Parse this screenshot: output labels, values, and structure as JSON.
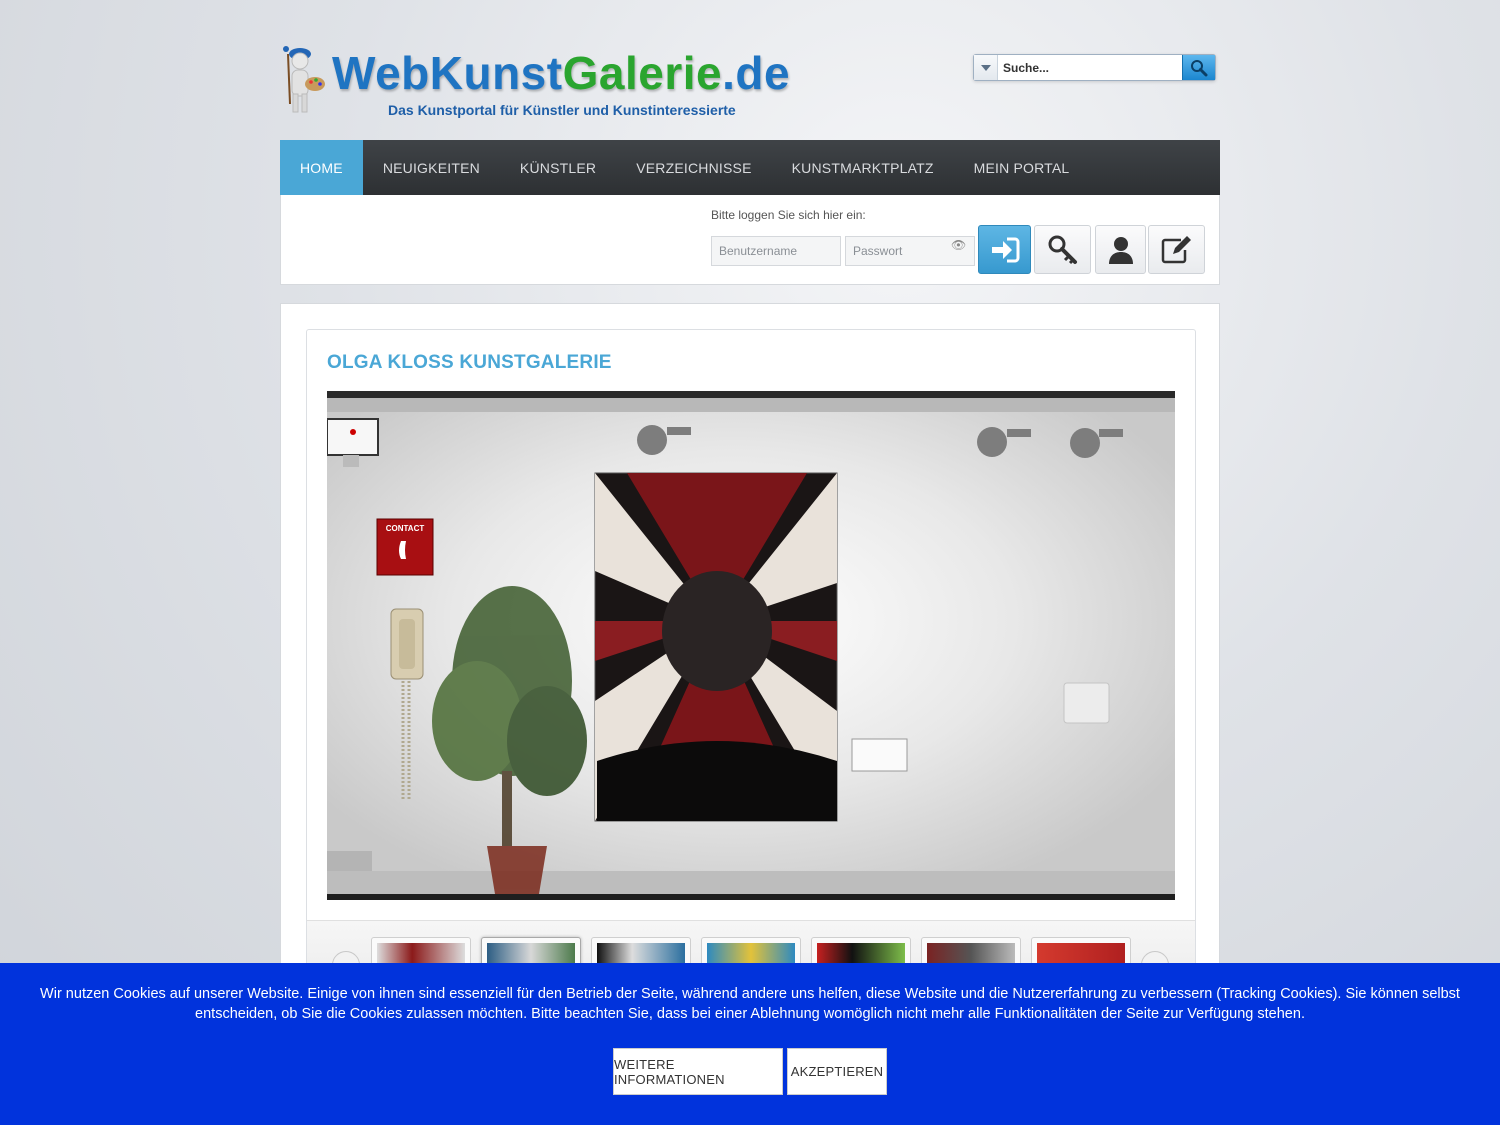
{
  "header": {
    "logo_title_a": "WebKunst",
    "logo_title_b": "Galerie",
    "logo_title_c": ".de",
    "logo_subtitle": "Das Kunstportal für Künstler und Kunstinteressierte"
  },
  "search": {
    "placeholder": "Suche..."
  },
  "nav": {
    "items": [
      {
        "label": "HOME",
        "active": true
      },
      {
        "label": "NEUIGKEITEN"
      },
      {
        "label": "KÜNSTLER"
      },
      {
        "label": "VERZEICHNISSE"
      },
      {
        "label": "KUNSTMARKTPLATZ"
      },
      {
        "label": "MEIN PORTAL"
      }
    ]
  },
  "login": {
    "prompt": "Bitte loggen Sie sich hier ein:",
    "username_placeholder": "Benutzername",
    "password_placeholder": "Passwort"
  },
  "gallery": {
    "title": "OLGA KLOSS KUNSTGALERIE",
    "contact_sign": "CONTACT"
  },
  "cookie": {
    "text": "Wir nutzen Cookies auf unserer Website. Einige von ihnen sind essenziell für den Betrieb der Seite, während andere uns helfen, diese Website und die Nutzererfahrung zu verbessern (Tracking Cookies). Sie können selbst entscheiden, ob Sie die Cookies zulassen möchten. Bitte beachten Sie, dass bei einer Ablehnung womöglich nicht mehr alle Funktionalitäten der Seite zur Verfügung stehen.",
    "more_info_label": "WEITERE INFORMATIONEN",
    "accept_label": "AKZEPTIEREN",
    "background_color": "#0133dc"
  },
  "colors": {
    "accent": "#4aa7d6",
    "nav_bg": "#2d3033"
  }
}
